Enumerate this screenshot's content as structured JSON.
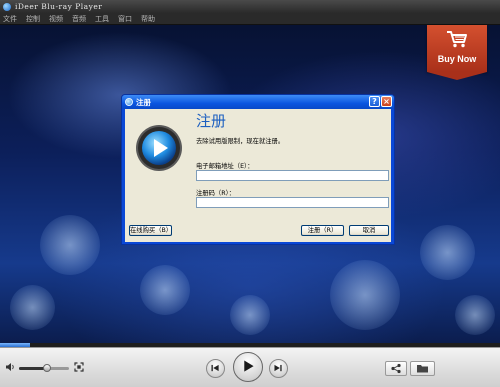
{
  "app": {
    "title": "iDeer Blu-ray Player"
  },
  "menu": {
    "items": [
      "文件",
      "控制",
      "视频",
      "音频",
      "工具",
      "窗口",
      "帮助"
    ]
  },
  "promo": {
    "buy_now": "Buy Now",
    "color": "#c2391c"
  },
  "dialog": {
    "title": "注册",
    "heading": "注册",
    "description": "去除试用版限制，现在就注册。",
    "email_label": "电子邮箱地址（E）：",
    "email_value": "",
    "code_label": "注册码（R）：",
    "code_value": "",
    "buy_online_button": "在线购买（B）",
    "register_button": "注册（R）",
    "cancel_button": "取消",
    "help_button": "?",
    "close_button": "×"
  },
  "playback": {
    "progress_percent": 6,
    "volume_percent": 55
  },
  "colors": {
    "accent": "#0a55e0",
    "heading": "#1c5fc0"
  }
}
